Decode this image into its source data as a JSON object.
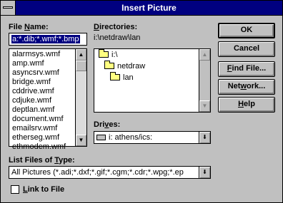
{
  "window": {
    "title": "Insert Picture"
  },
  "file_name": {
    "label_pre": "File ",
    "label_key": "N",
    "label_post": "ame:",
    "value": "a:*.dib;*.wmf;*.bmp",
    "files": [
      "alarmsys.wmf",
      "amp.wmf",
      "asyncsrv.wmf",
      "bridge.wmf",
      "cddrive.wmf",
      "cdjuke.wmf",
      "deptlan.wmf",
      "document.wmf",
      "emailsrv.wmf",
      "etherseg.wmf",
      "ethmodem.wmf"
    ]
  },
  "directories": {
    "label_key": "D",
    "label_post": "irectories:",
    "current_path": "i:\\netdraw\\lan",
    "items": [
      "i:\\",
      "netdraw",
      "lan"
    ]
  },
  "drives": {
    "label_pre": "Dri",
    "label_key": "v",
    "label_post": "es:",
    "value": "i: athens/ics:"
  },
  "file_type": {
    "label_pre": "List Files of ",
    "label_key": "T",
    "label_post": "ype:",
    "value": "All Pictures (*.adi;*.dxf;*.gif;*.cgm;*.cdr;*.wpg;*.ep"
  },
  "link": {
    "label_key": "L",
    "label_post": "ink to File",
    "checked": false
  },
  "buttons": {
    "ok": "OK",
    "cancel": "Cancel",
    "find_key": "F",
    "find_post": "ind File...",
    "network_pre": "Net",
    "network_key": "w",
    "network_post": "ork...",
    "help_key": "H",
    "help_post": "elp"
  }
}
